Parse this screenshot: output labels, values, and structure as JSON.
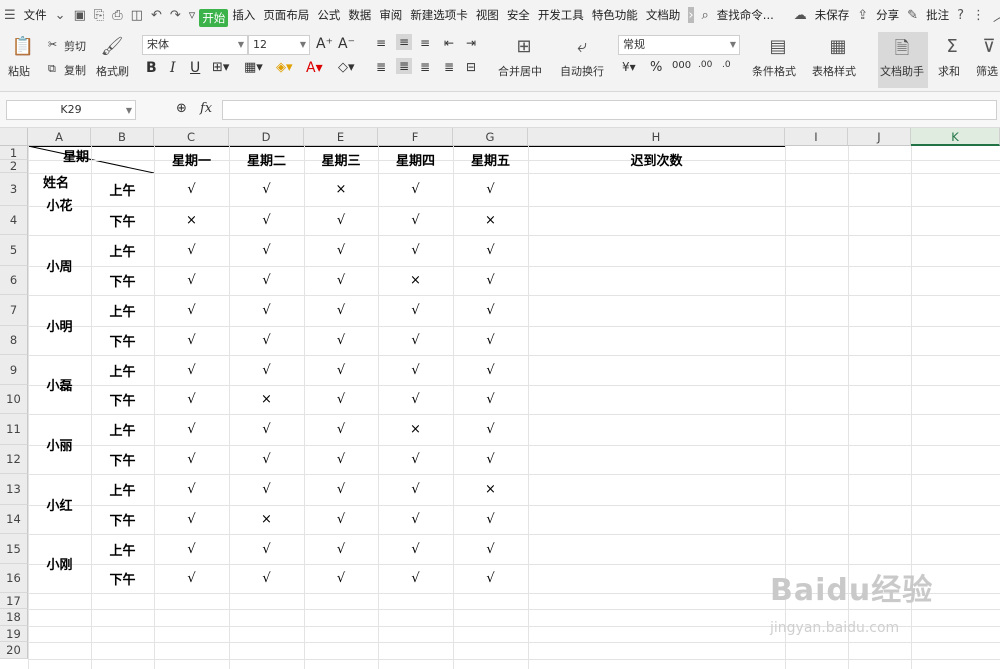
{
  "menubar": {
    "file": "文件",
    "tabs": [
      "开始",
      "插入",
      "页面布局",
      "公式",
      "数据",
      "审阅",
      "新建选项卡",
      "视图",
      "安全",
      "开发工具",
      "特色功能",
      "文档助"
    ],
    "search": "查找命令...",
    "unsaved": "未保存",
    "share": "分享",
    "comment": "批注"
  },
  "ribbon": {
    "paste": "粘贴",
    "cut": "剪切",
    "copy": "复制",
    "format_painter": "格式刷",
    "font_name": "宋体",
    "font_size": "12",
    "merge_center": "合并居中",
    "wrap_text": "自动换行",
    "number_format": "常规",
    "cond_format": "条件格式",
    "table_style": "表格样式",
    "doc_helper": "文档助手",
    "sum": "求和",
    "filter": "筛选"
  },
  "formula_bar": {
    "name_box": "K29",
    "fx": "fx",
    "value": ""
  },
  "columns": [
    "A",
    "B",
    "C",
    "D",
    "E",
    "F",
    "G",
    "H",
    "I",
    "J",
    "K"
  ],
  "rows": [
    "1",
    "2",
    "3",
    "4",
    "5",
    "6",
    "7",
    "8",
    "9",
    "10",
    "11",
    "12",
    "13",
    "14",
    "15",
    "16",
    "17",
    "18",
    "19",
    "20"
  ],
  "table": {
    "corner_top": "星期",
    "corner_bottom": "姓名",
    "days": [
      "星期一",
      "星期二",
      "星期三",
      "星期四",
      "星期五"
    ],
    "late_header": "迟到次数",
    "am": "上午",
    "pm": "下午",
    "people": [
      {
        "name": "小花",
        "am": [
          "√",
          "√",
          "×",
          "√",
          "√"
        ],
        "pm": [
          "×",
          "√",
          "√",
          "√",
          "×"
        ]
      },
      {
        "name": "小周",
        "am": [
          "√",
          "√",
          "√",
          "√",
          "√"
        ],
        "pm": [
          "√",
          "√",
          "√",
          "×",
          "√"
        ]
      },
      {
        "name": "小明",
        "am": [
          "√",
          "√",
          "√",
          "√",
          "√"
        ],
        "pm": [
          "√",
          "√",
          "√",
          "√",
          "√"
        ]
      },
      {
        "name": "小磊",
        "am": [
          "√",
          "√",
          "√",
          "√",
          "√"
        ],
        "pm": [
          "√",
          "×",
          "√",
          "√",
          "√"
        ]
      },
      {
        "name": "小丽",
        "am": [
          "√",
          "√",
          "√",
          "×",
          "√"
        ],
        "pm": [
          "√",
          "√",
          "√",
          "√",
          "√"
        ]
      },
      {
        "name": "小红",
        "am": [
          "√",
          "√",
          "√",
          "√",
          "×"
        ],
        "pm": [
          "√",
          "×",
          "√",
          "√",
          "√"
        ]
      },
      {
        "name": "小刚",
        "am": [
          "√",
          "√",
          "√",
          "√",
          "√"
        ],
        "pm": [
          "√",
          "√",
          "√",
          "√",
          "√"
        ]
      }
    ]
  },
  "watermark": {
    "main": "Baidu经验",
    "sub": "jingyan.baidu.com"
  }
}
